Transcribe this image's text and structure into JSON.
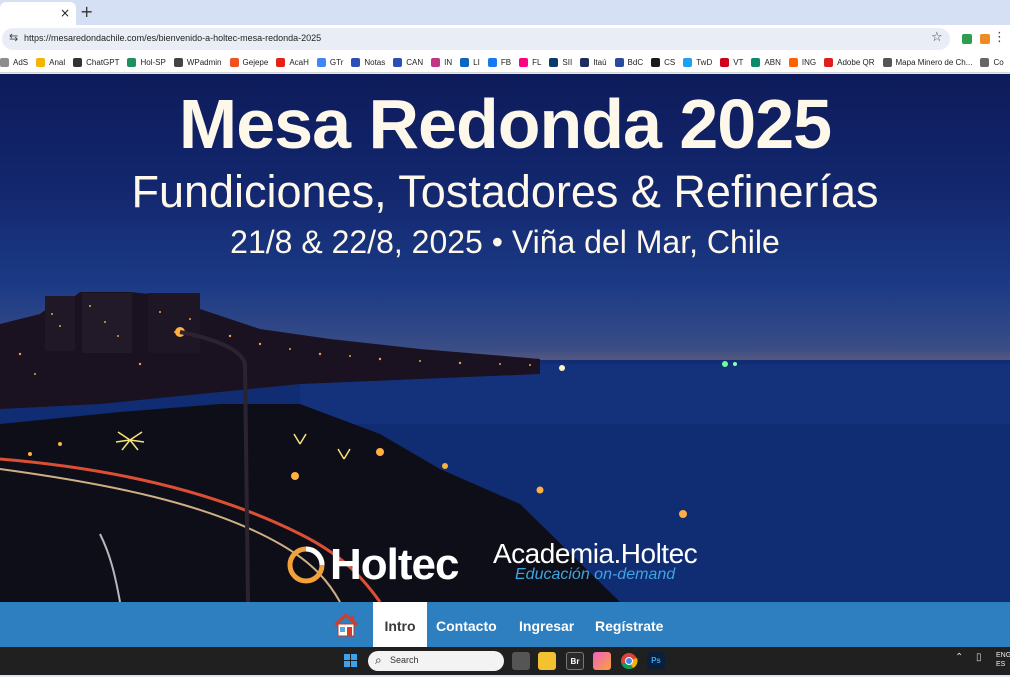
{
  "browser": {
    "tab_close": "×",
    "new_tab": "+",
    "url": "https://mesaredondachile.com/es/bienvenido-a-holtec-mesa-redonda-2025",
    "bookmarks": [
      {
        "label": "AdS",
        "color": "#8d8d8d"
      },
      {
        "label": "Anal",
        "color": "#f4b400"
      },
      {
        "label": "ChatGPT",
        "color": "#333333"
      },
      {
        "label": "Hol-SP",
        "color": "#1f8f5f"
      },
      {
        "label": "WPadmin",
        "color": "#444444"
      },
      {
        "label": "Gejepe",
        "color": "#f25022"
      },
      {
        "label": "AcaH",
        "color": "#e62117"
      },
      {
        "label": "GTr",
        "color": "#4285f4"
      },
      {
        "label": "Notas",
        "color": "#2b4fb5"
      },
      {
        "label": "CAN",
        "color": "#2b4fb5"
      },
      {
        "label": "IN",
        "color": "#c13584"
      },
      {
        "label": "LI",
        "color": "#0a66c2"
      },
      {
        "label": "FB",
        "color": "#1877f2"
      },
      {
        "label": "FL",
        "color": "#ff0084"
      },
      {
        "label": "SII",
        "color": "#0b3a6e"
      },
      {
        "label": "Itaú",
        "color": "#1b2d5e"
      },
      {
        "label": "BdC",
        "color": "#2a4b9b"
      },
      {
        "label": "CS",
        "color": "#1a1a1a"
      },
      {
        "label": "TwD",
        "color": "#1da1f2"
      },
      {
        "label": "VT",
        "color": "#d0021b"
      },
      {
        "label": "ABN",
        "color": "#0d8a6a"
      },
      {
        "label": "ING",
        "color": "#ff6200"
      },
      {
        "label": "Adobe QR",
        "color": "#e01e1e"
      },
      {
        "label": "Mapa Minero de Ch...",
        "color": "#555555"
      },
      {
        "label": "Co",
        "color": "#666666"
      }
    ]
  },
  "hero": {
    "title": "Mesa Redonda 2025",
    "subtitle": "Fundiciones, Tostadores & Refinerías",
    "date_location": "21/8 & 22/8, 2025 • Viña del Mar, Chile",
    "logo_holtec": "Holtec",
    "academia_name": "Academia.Holtec",
    "academia_tagline": "Educación on-demand"
  },
  "nav": {
    "items": [
      {
        "label": "Intro",
        "active": true
      },
      {
        "label": "Contacto",
        "active": false
      },
      {
        "label": "Ingresar",
        "active": false
      },
      {
        "label": "Regístrate",
        "active": false
      }
    ]
  },
  "taskbar": {
    "search_placeholder": "Search",
    "app_br": "Br",
    "app_ps": "Ps",
    "lang_line1": "ENG",
    "lang_line2": "ES"
  }
}
